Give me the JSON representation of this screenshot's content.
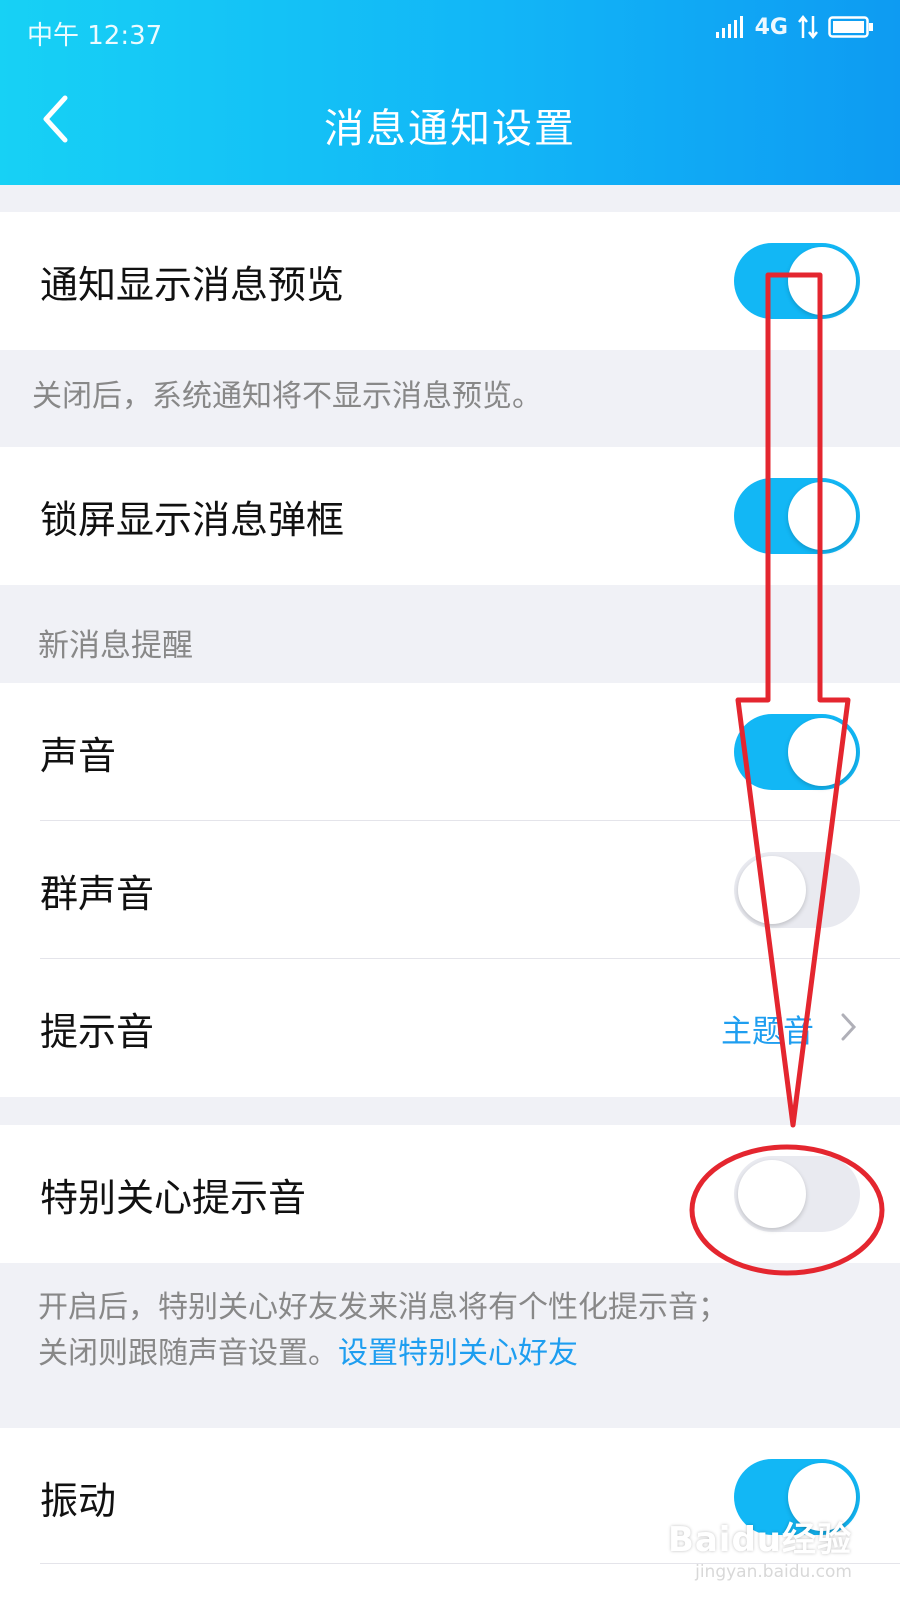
{
  "status_bar": {
    "time": "中午 12:37",
    "network": "4G"
  },
  "header": {
    "title": "消息通知设置"
  },
  "settings": {
    "preview": {
      "label": "通知显示消息预览",
      "enabled": true
    },
    "preview_note": "关闭后，系统通知将不显示消息预览。",
    "lock_screen": {
      "label": "锁屏显示消息弹框",
      "enabled": true
    },
    "section_title": "新消息提醒",
    "sound": {
      "label": "声音",
      "enabled": true
    },
    "group_sound": {
      "label": "群声音",
      "enabled": false
    },
    "tone": {
      "label": "提示音",
      "value": "主题音"
    },
    "special_care": {
      "label": "特别关心提示音",
      "enabled": false
    },
    "special_note": {
      "line1": "开启后，特别关心好友发来消息将有个性化提示音；",
      "line2": "关闭则跟随声音设置。",
      "link": "设置特别关心好友"
    },
    "vibrate": {
      "label": "振动",
      "enabled": true
    }
  },
  "colors": {
    "accent": "#12b7f5",
    "annotation": "#e4262f",
    "link": "#1e9ef0"
  },
  "icons": {
    "back": "chevron-left-icon",
    "chevron": "chevron-right-icon",
    "signal": "signal-icon",
    "battery": "battery-icon"
  },
  "watermark": {
    "brand": "Baidu经验",
    "url": "jingyan.baidu.com"
  }
}
